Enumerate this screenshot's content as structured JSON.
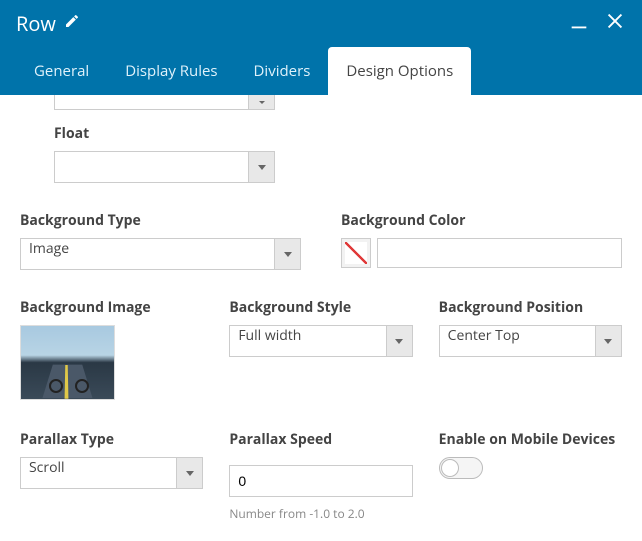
{
  "header": {
    "title": "Row"
  },
  "tabs": {
    "general": "General",
    "display_rules": "Display Rules",
    "dividers": "Dividers",
    "design_options": "Design Options"
  },
  "fields": {
    "float": {
      "label": "Float",
      "value": ""
    },
    "bg_type": {
      "label": "Background Type",
      "value": "Image"
    },
    "bg_color": {
      "label": "Background Color",
      "value": ""
    },
    "bg_image": {
      "label": "Background Image"
    },
    "bg_style": {
      "label": "Background Style",
      "value": "Full width"
    },
    "bg_position": {
      "label": "Background Position",
      "value": "Center Top"
    },
    "parallax_type": {
      "label": "Parallax Type",
      "value": "Scroll"
    },
    "parallax_speed": {
      "label": "Parallax Speed",
      "value": "0",
      "hint": "Number from -1.0 to 2.0"
    },
    "enable_mobile": {
      "label": "Enable on Mobile Devices",
      "value": false
    }
  }
}
